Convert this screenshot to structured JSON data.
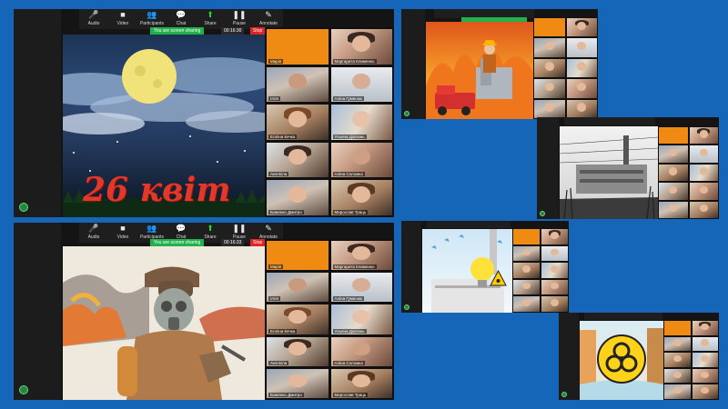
{
  "toolbar": {
    "items": [
      {
        "label": "Audio",
        "icon": "microphone-icon"
      },
      {
        "label": "Video",
        "icon": "camera-icon"
      },
      {
        "label": "Participants",
        "icon": "participants-icon"
      },
      {
        "label": "Chat",
        "icon": "chat-icon"
      },
      {
        "label": "Share",
        "icon": "share-screen-icon"
      },
      {
        "label": "Pause",
        "icon": "pause-icon"
      },
      {
        "label": "Annotate",
        "icon": "annotate-icon"
      }
    ]
  },
  "sharing_banner": "You are screen sharing",
  "stop_label": "Stop",
  "shots": {
    "moon": {
      "timer": "00:16:30",
      "slide_text": "26 квіт"
    },
    "firefighter": {
      "timer": "00:16:33"
    }
  },
  "participants": {
    "p1": "Марія",
    "p2": "Маргарита Клименко",
    "p3": "Ілля",
    "p4": "Аліна Гуменюк",
    "p5": "Елліна Кечка",
    "p6": "Ульяна Довгань",
    "p7": "Аня Біла",
    "p8": "Аліна Соломка",
    "p9": "Боженко Дмитро",
    "p10": "Мирослав Траць"
  },
  "colors": {
    "background": "#1565b8",
    "share_green": "#23b14d",
    "stop_red": "#e02424",
    "tile_orange": "#ef8b12"
  }
}
